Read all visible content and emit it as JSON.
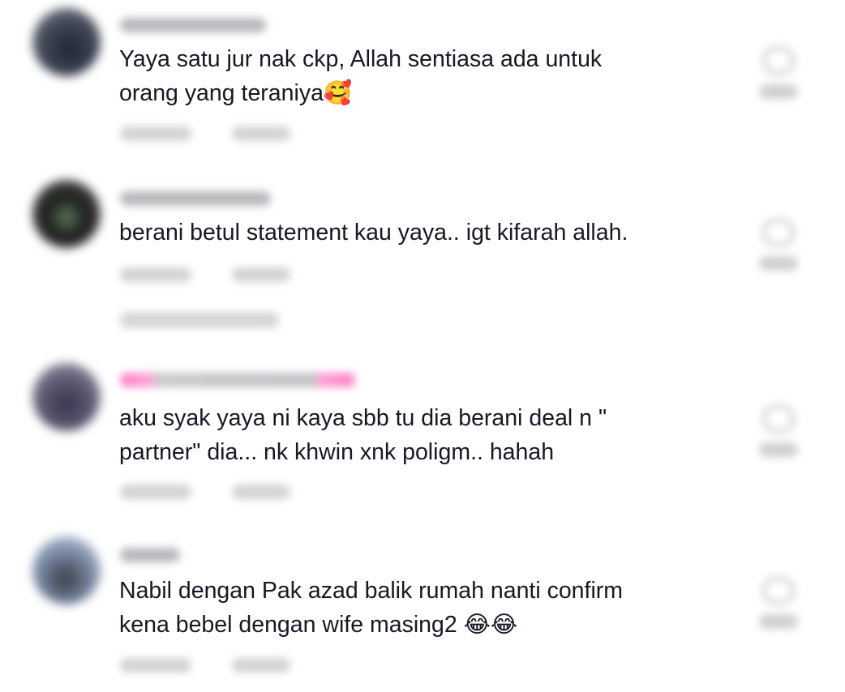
{
  "comments": [
    {
      "text": "Yaya satu jur nak ckp, Allah sentiasa ada untuk\norang yang teraniya🥰",
      "avatar_color": "#3d4452",
      "has_view_replies": false
    },
    {
      "text": "berani betul statement kau yaya.. igt kifarah allah.",
      "avatar_color": "#2b2b2b",
      "has_view_replies": true
    },
    {
      "text": "aku syak yaya ni kaya sbb tu dia berani deal n \"\npartner\" dia... nk khwin xnk poligm.. hahah",
      "avatar_color": "#5b5870",
      "username_color": "#ff7ec8",
      "has_view_replies": false
    },
    {
      "text": "Nabil dengan Pak azad balik rumah nanti confirm\nkena bebel dengan wife masing2 😂😂",
      "avatar_color": "#9fb7d8",
      "has_view_replies": false
    }
  ]
}
